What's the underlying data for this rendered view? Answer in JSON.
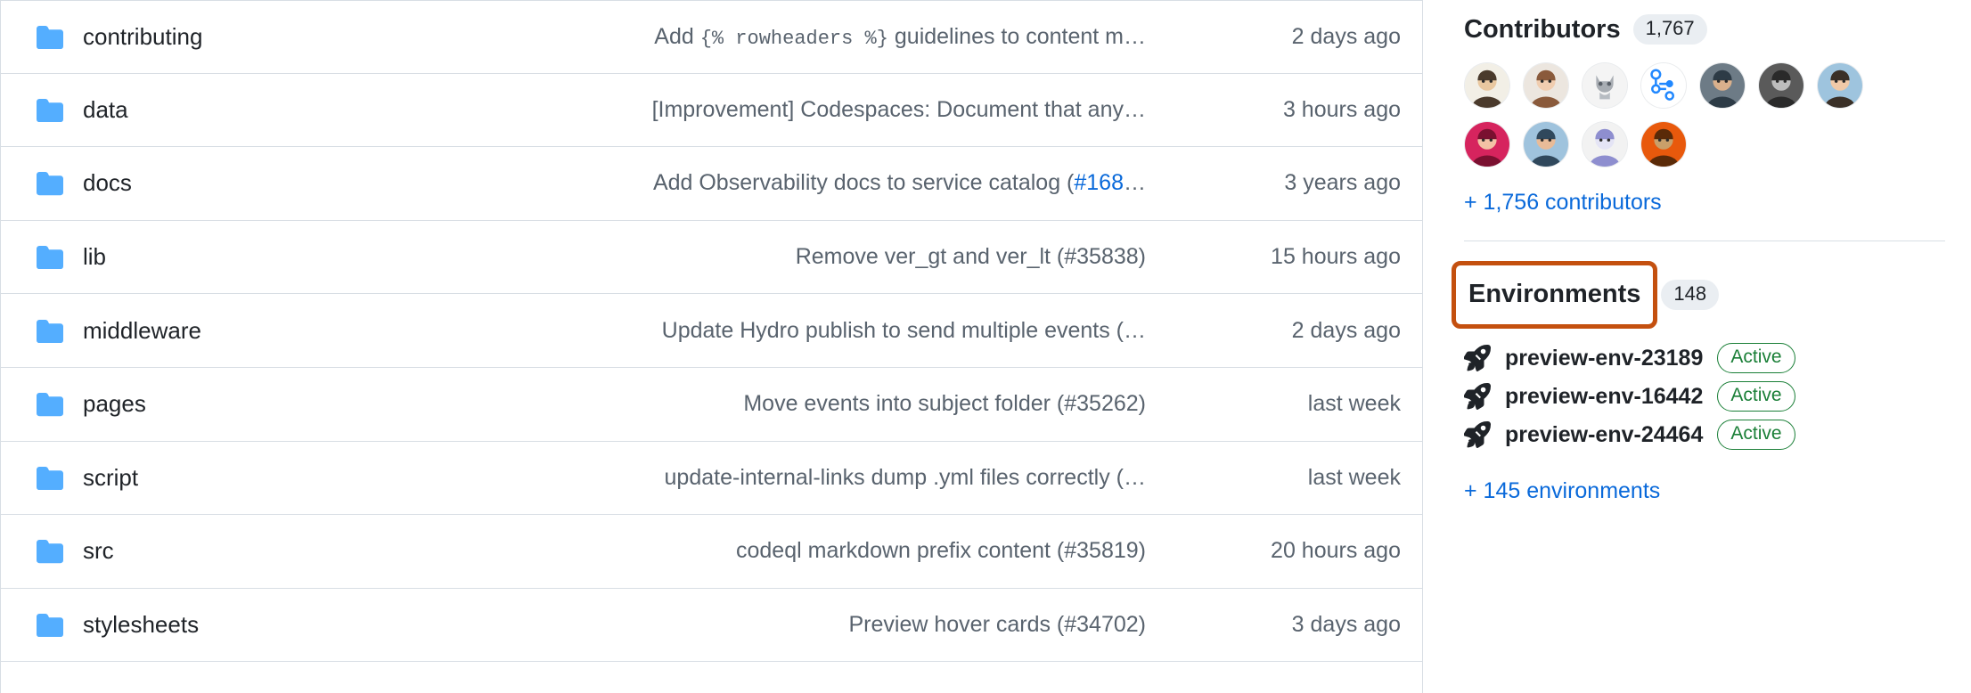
{
  "files": {
    "rows": [
      {
        "name": "contributing",
        "message_prefix": "Add ",
        "message_code": "{% rowheaders %}",
        "message_suffix": " guidelines to content m…",
        "pr": "",
        "message_tail": "",
        "time": "2 days ago"
      },
      {
        "name": "data",
        "message_prefix": "[Improvement] Codespaces: Document that any…",
        "message_code": "",
        "message_suffix": "",
        "pr": "",
        "message_tail": "",
        "time": "3 hours ago"
      },
      {
        "name": "docs",
        "message_prefix": "Add Observability docs to service catalog (",
        "message_code": "",
        "message_suffix": "",
        "pr": "#168",
        "message_tail": "…",
        "time": "3 years ago"
      },
      {
        "name": "lib",
        "message_prefix": "Remove ver_gt and ver_lt (#35838)",
        "message_code": "",
        "message_suffix": "",
        "pr": "",
        "message_tail": "",
        "time": "15 hours ago"
      },
      {
        "name": "middleware",
        "message_prefix": "Update Hydro publish to send multiple events (…",
        "message_code": "",
        "message_suffix": "",
        "pr": "",
        "message_tail": "",
        "time": "2 days ago"
      },
      {
        "name": "pages",
        "message_prefix": "Move events into subject folder (#35262)",
        "message_code": "",
        "message_suffix": "",
        "pr": "",
        "message_tail": "",
        "time": "last week"
      },
      {
        "name": "script",
        "message_prefix": "update-internal-links dump .yml files correctly (…",
        "message_code": "",
        "message_suffix": "",
        "pr": "",
        "message_tail": "",
        "time": "last week"
      },
      {
        "name": "src",
        "message_prefix": "codeql markdown prefix content (#35819)",
        "message_code": "",
        "message_suffix": "",
        "pr": "",
        "message_tail": "",
        "time": "20 hours ago"
      },
      {
        "name": "stylesheets",
        "message_prefix": "Preview hover cards (#34702)",
        "message_code": "",
        "message_suffix": "",
        "pr": "",
        "message_tail": "",
        "time": "3 days ago"
      }
    ],
    "folder_icon": "folder-icon",
    "folder_color": "#54aeff"
  },
  "sidebar": {
    "contributors": {
      "title": "Contributors",
      "count": "1,767",
      "more_link": "+ 1,756 contributors",
      "avatar_count": 11
    },
    "environments": {
      "title": "Environments",
      "count": "148",
      "highlight_color": "#c4500f",
      "rocket_icon": "rocket-icon",
      "items": [
        {
          "name": "preview-env-23189",
          "status": "Active"
        },
        {
          "name": "preview-env-16442",
          "status": "Active"
        },
        {
          "name": "preview-env-24464",
          "status": "Active"
        }
      ],
      "more_link": "+ 145 environments"
    }
  },
  "colors": {
    "link": "#0969da",
    "muted_text": "#59636e",
    "strong_text": "#1f2328",
    "border": "#d8dee4",
    "success": "#1a7f37",
    "highlight": "#c4500f"
  }
}
